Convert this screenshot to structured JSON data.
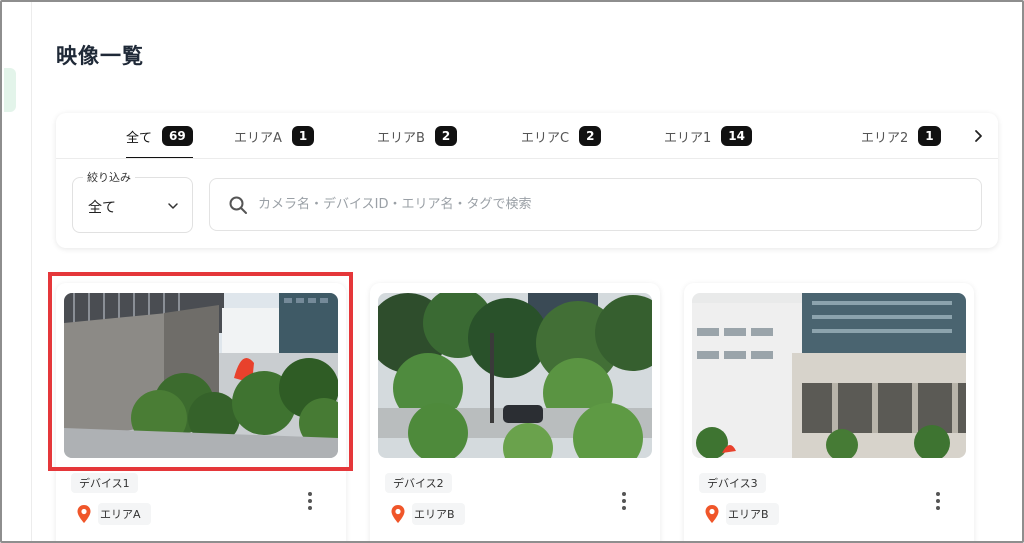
{
  "page": {
    "title": "映像一覧"
  },
  "tabs": [
    {
      "label": "全て",
      "count": "69",
      "active": true
    },
    {
      "label": "エリアA",
      "count": "1"
    },
    {
      "label": "エリアB",
      "count": "2"
    },
    {
      "label": "エリアC",
      "count": "2"
    },
    {
      "label": "エリア1",
      "count": "14"
    },
    {
      "label": "エリア2",
      "count": "1"
    }
  ],
  "filter": {
    "label": "絞り込み",
    "value": "全て"
  },
  "search": {
    "placeholder": "カメラ名・デバイスID・エリア名・タグで検索",
    "value": ""
  },
  "cards": [
    {
      "device": "デバイス1",
      "area": "エリアA",
      "selected": true
    },
    {
      "device": "デバイス2",
      "area": "エリアB"
    },
    {
      "device": "デバイス3",
      "area": "エリアB"
    }
  ],
  "icons": {
    "search": "search-icon",
    "chevron_down": "chevron-down-icon",
    "chevron_right": "chevron-right-icon",
    "pin": "location-pin-icon",
    "more": "more-vertical-icon"
  },
  "colors": {
    "accent_badge": "#111111",
    "pin": "#f0562a",
    "highlight": "#e5373a"
  }
}
